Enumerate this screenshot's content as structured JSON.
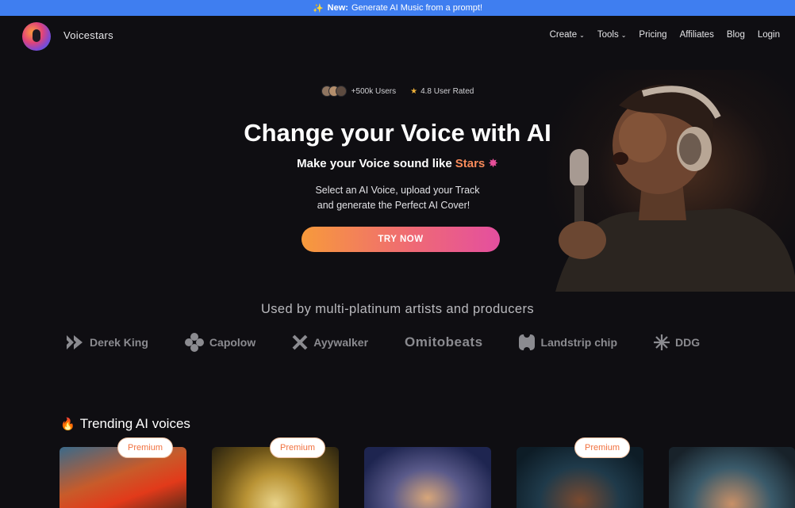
{
  "banner": {
    "icon": "sparkle-icon",
    "prefix": "New:",
    "text": "Generate AI Music from a prompt!"
  },
  "nav": {
    "brand": "Voicestars",
    "items": [
      {
        "label": "Create",
        "dropdown": true
      },
      {
        "label": "Tools",
        "dropdown": true
      },
      {
        "label": "Pricing",
        "dropdown": false
      },
      {
        "label": "Affiliates",
        "dropdown": false
      },
      {
        "label": "Blog",
        "dropdown": false
      },
      {
        "label": "Login",
        "dropdown": false
      }
    ]
  },
  "hero": {
    "users": "+500k Users",
    "rating": "4.8 User Rated",
    "title": "Change your Voice with AI",
    "subtitle": "Make your Voice sound like",
    "subtitle_accent": "Stars",
    "desc_line1": "Select an AI Voice, upload your Track",
    "desc_line2": "and generate the Perfect AI Cover!",
    "cta": "TRY NOW"
  },
  "used_by": "Used by multi-platinum artists and producers",
  "partners": [
    {
      "name": "Derek King",
      "icon": "chevrons-icon"
    },
    {
      "name": "Capolow",
      "icon": "clover-icon"
    },
    {
      "name": "Ayywalker",
      "icon": "x-mark-icon"
    },
    {
      "name": "Omitobeats",
      "icon": ""
    },
    {
      "name": "Landstrip chip",
      "icon": "puzzle-icon"
    },
    {
      "name": "DDG",
      "icon": "asterisk-icon"
    }
  ],
  "trending": {
    "icon": "fire-icon",
    "title": "Trending AI voices",
    "cards": [
      {
        "badge": "Premium"
      },
      {
        "badge": "Premium"
      },
      {
        "badge": ""
      },
      {
        "badge": "Premium"
      },
      {
        "badge": ""
      }
    ]
  },
  "colors": {
    "banner": "#3f7ef0",
    "background": "#0f0e12",
    "cta_start": "#f79a3b",
    "cta_end": "#e44f9f",
    "accent": "#f78a5a",
    "badge_text": "#f1703e"
  }
}
